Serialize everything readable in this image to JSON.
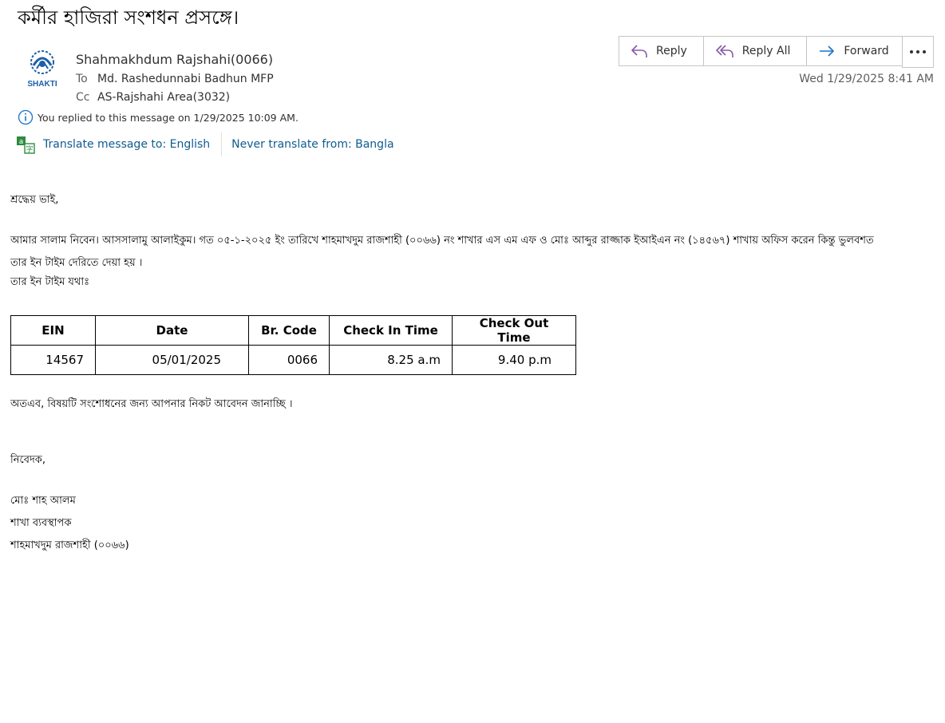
{
  "subject": "কর্মীর হাজিরা সংশধন প্রসঙ্গে।",
  "sender": {
    "avatar_text": "SHAKTI",
    "name": "Shahmakhdum Rajshahi(0066)",
    "to_label": "To",
    "to_value": "Md. Rashedunnabi Badhun MFP",
    "cc_label": "Cc",
    "cc_value": "AS-Rajshahi Area(3032)"
  },
  "actions": {
    "reply": "Reply",
    "reply_all": "Reply All",
    "forward": "Forward"
  },
  "timestamp": "Wed 1/29/2025 8:41 AM",
  "info": "You replied to this message on 1/29/2025 10:09 AM.",
  "translate": {
    "translate_link": "Translate message to: English",
    "never_link": "Never translate from: Bangla"
  },
  "body": {
    "greeting": "শ্রদ্ধেয় ভাই,",
    "para1_line1": "আমার সালাম নিবেন। আসসালামু আলাইকুম। গত ০৫-১-২০২৫  ইং তারিখে শাহমাখদুম রাজশাহী  (০০৬৬) নং শাখার এস এম এফ ও  মোঃ আব্দুর রাজ্জাক   ইআইএন নং (১৪৫৬৭)  শাখায় অফিস করেন কিন্তু ভুলবশত",
    "para1_line2": "তার  ইন টাইম দেরিতে দেয়া হয়  ।",
    "para1_line3": "তার ইন টাইম যথাঃ",
    "request": "অতএব, বিষয়টি সংশোধনের জন্য  আপনার নিকট আবেদন জানাচ্ছি  ।",
    "closing": "নিবেদক,",
    "sig_name": "মোঃ শাহ আলম",
    "sig_title": "শাখা ব্যবস্থাপক",
    "sig_branch": "শাহমাখদুম  রাজশাহী (০০৬৬)"
  },
  "table": {
    "headers": [
      "EIN",
      "Date",
      "Br. Code",
      "Check In Time",
      "Check Out Time"
    ],
    "row": [
      "14567",
      "05/01/2025",
      "0066",
      "8.25 a.m",
      "9.40 p.m"
    ]
  },
  "colors": {
    "link": "#0f5c8f",
    "icon_purple": "#8a5aa8",
    "icon_blue": "#1a73c7",
    "logo_blue": "#1d5fa8",
    "translate_green": "#2e8b3e"
  },
  "icons": {
    "reply": "reply-arrow-icon",
    "reply_all": "reply-all-arrow-icon",
    "forward": "forward-arrow-icon",
    "more": "more-ellipsis-icon",
    "info": "info-circle-icon",
    "translate": "translate-icon"
  }
}
